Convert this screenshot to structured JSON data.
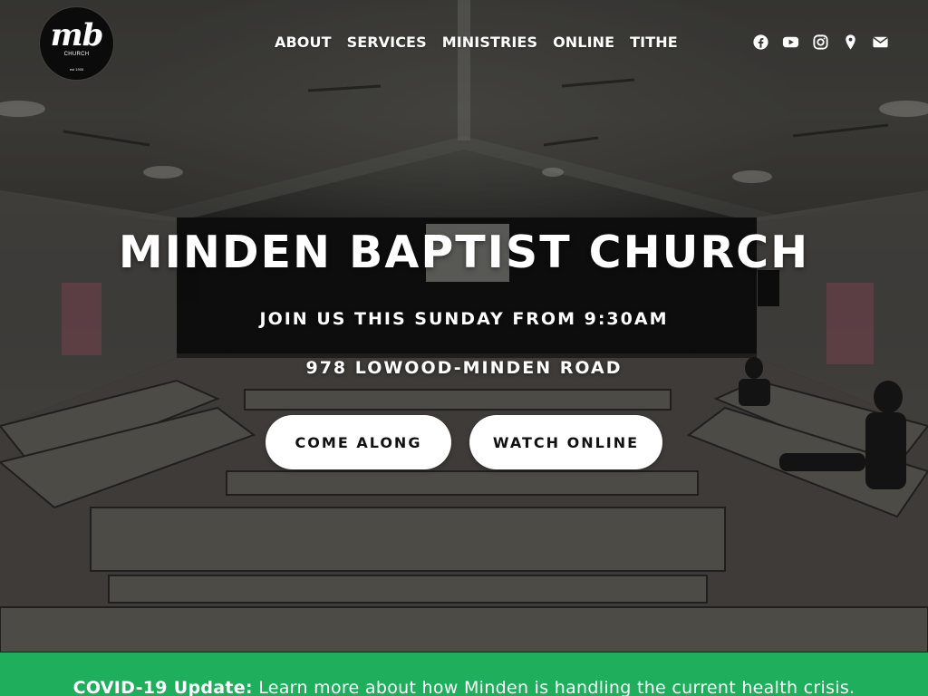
{
  "logo": {
    "mark": "mb",
    "sub": "CHURCH",
    "est": "est 1905"
  },
  "nav": {
    "items": [
      {
        "label": "ABOUT"
      },
      {
        "label": "SERVICES"
      },
      {
        "label": "MINISTRIES"
      },
      {
        "label": "ONLINE"
      },
      {
        "label": "TITHE"
      }
    ]
  },
  "social": {
    "icons": [
      "facebook-icon",
      "youtube-icon",
      "instagram-icon",
      "map-marker-icon",
      "envelope-icon"
    ]
  },
  "hero": {
    "title": "MINDEN BAPTIST CHURCH",
    "subtitle": "JOIN US THIS SUNDAY FROM 9:30AM",
    "address": "978 LOWOOD-MINDEN ROAD",
    "buttons": {
      "come_along": "COME ALONG",
      "watch_online": "WATCH ONLINE"
    }
  },
  "banner": {
    "strong": "COVID-19 Update:",
    "text": "Learn more about how Minden is handling the current health crisis."
  },
  "colors": {
    "banner": "#1fae5b",
    "button_bg": "#ffffff",
    "logo_bg": "#0b0b0b",
    "text": "#ffffff"
  }
}
